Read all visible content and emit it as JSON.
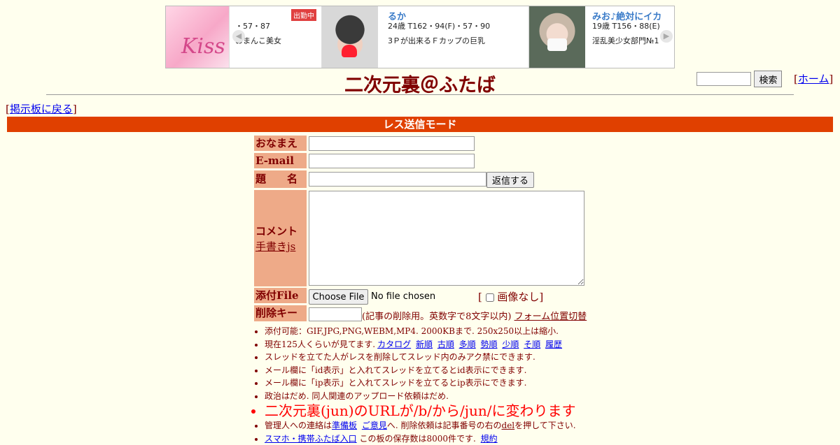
{
  "ad": {
    "card1": {
      "name": "",
      "spec": "・57・87",
      "desc": "おまんこ美女",
      "badge": "出勤中"
    },
    "card2": {
      "name": "るか",
      "spec": "24歳 T162・94(F)・57・90",
      "desc": "3Ｐが出来るＦカップの巨乳"
    },
    "card3": {
      "name": "みお♪絶対にイカ",
      "spec": "19歳 T156・88(E)",
      "desc": "淫乱美少女部門№1"
    },
    "logo_text": "Kiss"
  },
  "header": {
    "title": "二次元裏＠ふたば",
    "search_button": "検索",
    "home_link": "ホーム",
    "back_link": "掲示板に戻る"
  },
  "mode_bar": "レス送信モード",
  "form": {
    "name_label": "おなまえ",
    "email_label": "E-mail",
    "subject_label": "題　　名",
    "submit_button": "返信する",
    "comment_label": "コメント",
    "handwrite_link": "手書きjs",
    "file_label": "添付File",
    "choose_file_button": "Choose File",
    "no_file_text": "No file chosen",
    "no_image_label": "画像なし",
    "delete_key_label": "削除キー",
    "delete_key_note": "(記事の削除用。英数字で8文字以内)",
    "form_position_link": "フォーム位置切替"
  },
  "notes": {
    "n1": "添付可能：GIF,JPG,PNG,WEBM,MP4. 2000KBまで. 250x250以上は縮小.",
    "n2_prefix": "現在125人くらいが見てます.",
    "n2_links": [
      "カタログ",
      "新順",
      "古順",
      "多順",
      "勢順",
      "少順",
      "そ順",
      "履歴"
    ],
    "n3": "スレッドを立てた人がレスを削除してスレッド内のみアク禁にできます.",
    "n4": "メール欄に「id表示」と入れてスレッドを立てるとid表示にできます.",
    "n5": "メール欄に「ip表示」と入れてスレッドを立てるとip表示にできます.",
    "n6": "政治はだめ. 同人関連のアップロード依頼はだめ.",
    "n7": "二次元裏(jun)のURLが/b/から/jun/に変わります",
    "n8_a": "管理人への連絡は",
    "n8_link1": "準備板",
    "n8_link2": "ご意見",
    "n8_b": "へ. 削除依頼は記事番号の右の",
    "n8_del": "del",
    "n8_c": "を押して下さい.",
    "n9_link": "スマホ・携帯ふたば入口",
    "n9_text": "この板の保存数は8000件です.",
    "n9_link2": "規約"
  },
  "colors": {
    "background": "#ffffee",
    "text": "#800000",
    "label_bg": "#eeaa88",
    "mode_bar": "#e04000",
    "link": "#0000ee",
    "alert": "#ff0000"
  }
}
